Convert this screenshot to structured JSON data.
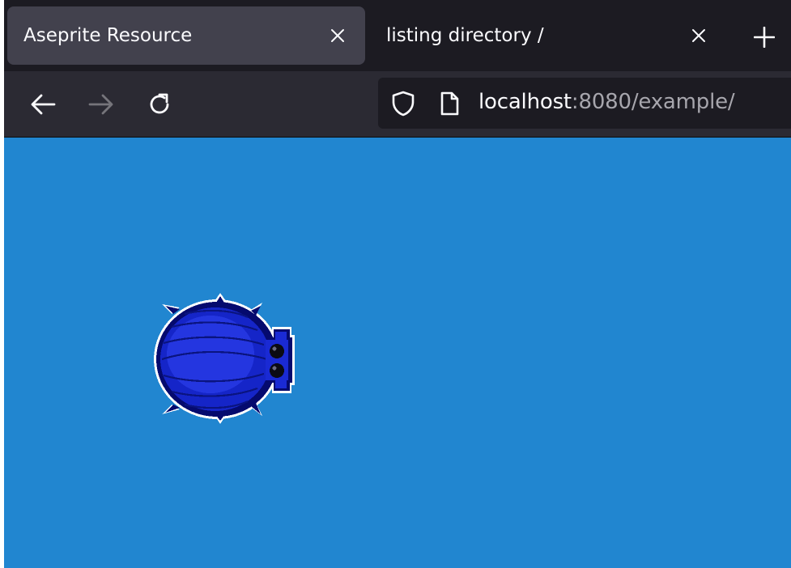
{
  "tabs": [
    {
      "title": "Aseprite Resource",
      "active": true
    },
    {
      "title": "listing directory /",
      "active": false
    }
  ],
  "toolbar": {
    "back_icon": "arrow-left-icon",
    "forward_icon": "arrow-right-icon",
    "reload_icon": "reload-icon",
    "new_tab_icon": "plus-icon"
  },
  "address": {
    "host": "localhost",
    "rest": ":8080/example/",
    "shield_icon": "shield-icon",
    "page_icon": "page-icon"
  },
  "page": {
    "background": "#2186d0",
    "sprite_icon": "beetle-sprite"
  }
}
